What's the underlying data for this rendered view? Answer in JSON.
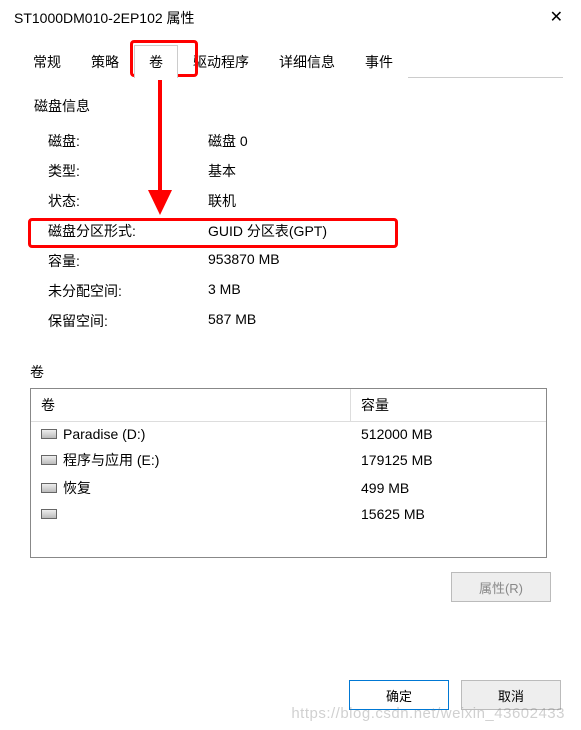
{
  "title": "ST1000DM010-2EP102 属性",
  "tabs": [
    "常规",
    "策略",
    "卷",
    "驱动程序",
    "详细信息",
    "事件"
  ],
  "active_tab_index": 2,
  "disk_info_header": "磁盘信息",
  "disk_info": [
    {
      "label": "磁盘:",
      "value": "磁盘 0"
    },
    {
      "label": "类型:",
      "value": "基本"
    },
    {
      "label": "状态:",
      "value": "联机"
    },
    {
      "label": "磁盘分区形式:",
      "value": "GUID 分区表(GPT)"
    },
    {
      "label": "容量:",
      "value": "953870 MB"
    },
    {
      "label": "未分配空间:",
      "value": "3 MB"
    },
    {
      "label": "保留空间:",
      "value": "587 MB"
    }
  ],
  "volumes_header": "卷",
  "vol_columns": {
    "name": "卷",
    "capacity": "容量"
  },
  "volumes": [
    {
      "name": "Paradise (D:)",
      "capacity": "512000 MB"
    },
    {
      "name": "程序与应用 (E:)",
      "capacity": "179125 MB"
    },
    {
      "name": "恢复",
      "capacity": "499 MB"
    },
    {
      "name": "",
      "capacity": "15625 MB"
    }
  ],
  "properties_btn": "属性(R)",
  "ok_btn": "确定",
  "cancel_btn": "取消",
  "watermark": "https://blog.csdn.net/weixin_43602433"
}
